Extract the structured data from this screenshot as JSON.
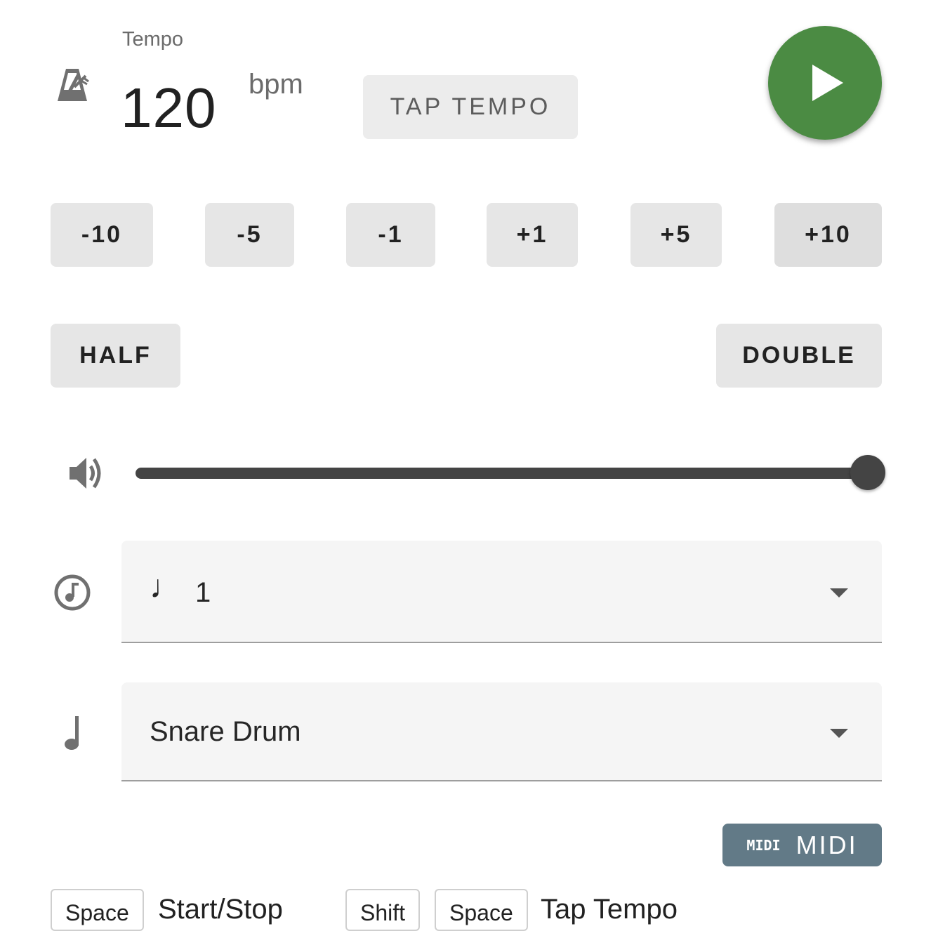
{
  "tempo": {
    "label": "Tempo",
    "value": "120",
    "unit": "bpm",
    "tap_label": "TAP TEMPO"
  },
  "play": {
    "icon": "play-icon",
    "color": "#4b8b43"
  },
  "steps": [
    "-10",
    "-5",
    "-1",
    "+1",
    "+5",
    "+10"
  ],
  "half_label": "HALF",
  "double_label": "DOUBLE",
  "volume": {
    "icon": "volume-icon",
    "level_fraction": 1.0
  },
  "subdivision": {
    "icon": "subdivision-icon",
    "note_glyph": "♩",
    "value": "1"
  },
  "sound": {
    "icon": "quarter-note-icon",
    "value": "Snare Drum"
  },
  "midi": {
    "logo": "MIDI",
    "label": "MIDI",
    "color": "#627a87"
  },
  "shortcuts": {
    "start_stop": {
      "keys": [
        "Space"
      ],
      "label": "Start/Stop"
    },
    "tap_tempo": {
      "keys": [
        "Shift",
        "Space"
      ],
      "label": "Tap Tempo"
    }
  }
}
